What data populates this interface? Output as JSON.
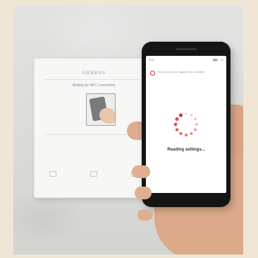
{
  "controller": {
    "brand": "SIEMENS",
    "message": "Waiting for NFC connection"
  },
  "phone": {
    "status_left": "9:41",
    "status_right": "▮▮▮ ◔ ▭",
    "prompt": "Hold your phone against the controller",
    "reading_label": "Reading settings...",
    "accent_color": "#d32f2f",
    "spinner_icon": "loading-spinner-icon"
  }
}
